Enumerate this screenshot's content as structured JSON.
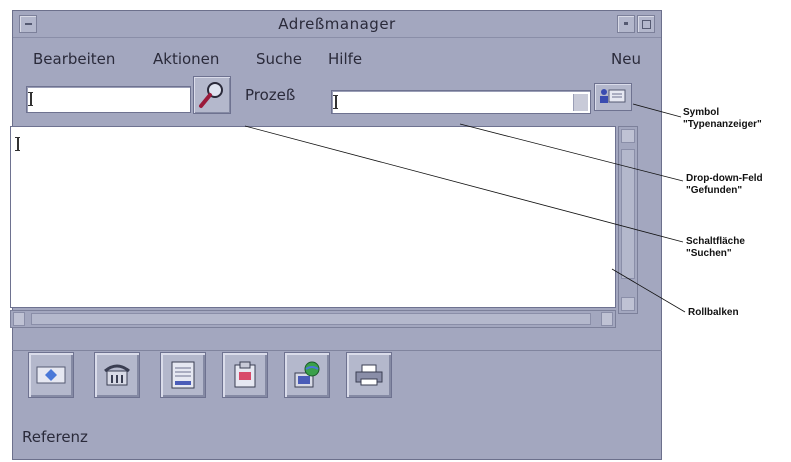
{
  "window": {
    "title": "Adreßmanager"
  },
  "menubar": {
    "items": [
      "Bearbeiten",
      "Aktionen",
      "Suche",
      "Hilfe"
    ],
    "right_item": "Neu"
  },
  "toolbar": {
    "search_input_value": "",
    "process_label": "Prozeß",
    "process_combo_value": ""
  },
  "results": {
    "text": ""
  },
  "tools": {
    "icons": [
      "card-icon",
      "phone-icon",
      "calendar-icon",
      "clipboard-icon",
      "globe-computer-icon",
      "printer-icon"
    ]
  },
  "status": {
    "text": "Referenz"
  },
  "callouts": {
    "type_indicator": [
      "Symbol",
      "\"Typenanzeiger\""
    ],
    "dropdown": [
      "Drop-down-Feld",
      "\"Gefunden\""
    ],
    "search_button": [
      "Schaltfläche",
      "\"Suchen\""
    ],
    "scrollbar": [
      "Rollbalken"
    ]
  },
  "colors": {
    "window_bg": "#a3a7bf",
    "field_bg": "#ffffff",
    "text": "#2a2a3a"
  }
}
